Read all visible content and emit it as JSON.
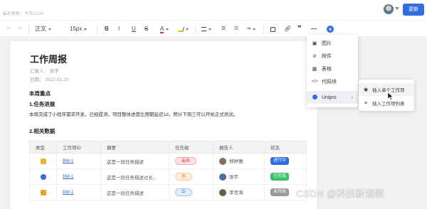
{
  "header": {
    "saved_text": "最后更新：今天15:34",
    "update_button": "更新"
  },
  "toolbar": {
    "undo": "↶",
    "redo": "↷",
    "paragraph": "正文",
    "font_size": "15px",
    "bold": "B",
    "italic": "I",
    "underline": "U",
    "strike": "S",
    "font_color": "A",
    "quote": "❞",
    "hr": "—",
    "plus": "+"
  },
  "doc": {
    "title": "工作周报",
    "reporter": "汇报人： 张宇",
    "date": "日期： 2022-01-20",
    "section_key": "本周重点",
    "sub1": "1.任务进展",
    "body": "本周完成了小程序需求开发，已经提测。项目整体进度比预期延迟1d，预计下周三可以开始正式测试。",
    "sub2": "2.相关数据"
  },
  "table": {
    "headers": [
      "类型",
      "工作项ID",
      "摘要",
      "优先级",
      "报告人",
      "状态"
    ],
    "rows": [
      {
        "type_icon": "bug-icon",
        "id": "BM-1",
        "summary": "这是一段任务描述",
        "priority": "最高",
        "reporter": "郑婷雅",
        "status": "进行中"
      },
      {
        "type_icon": "gear-icon",
        "id": "BM-1",
        "summary": "这是一段任务描述过长...",
        "priority": "高",
        "reporter": "张宇",
        "status": "已完成"
      },
      {
        "type_icon": "bookmark-icon",
        "id": "BM-1",
        "summary": "这是一段任务描述",
        "priority": "中",
        "reporter": "李世海",
        "status": "未开始"
      }
    ]
  },
  "insert_menu": {
    "items": [
      {
        "label": "图片",
        "icon": "image-icon"
      },
      {
        "label": "附件",
        "icon": "attachment-icon"
      },
      {
        "label": "表格",
        "icon": "table-icon"
      },
      {
        "label": "代码块",
        "icon": "code-icon"
      },
      {
        "label": "Unipro",
        "icon": "unipro-icon"
      }
    ]
  },
  "submenu": {
    "items": [
      {
        "label": "插入单个工作项",
        "icon": "target-icon"
      },
      {
        "label": "插入工作项列表",
        "icon": "list-icon"
      }
    ]
  },
  "watermark": "CSDN @科技新观察",
  "colors": {
    "accent": "#2f6de1",
    "status_running": "#2f6de1",
    "status_done": "#3cc06b",
    "status_todo": "#9a9a9a"
  }
}
